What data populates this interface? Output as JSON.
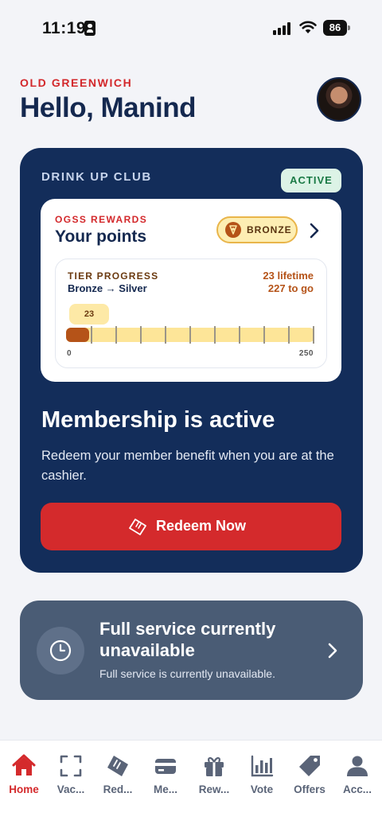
{
  "status_bar": {
    "time": "11:19",
    "battery": "86"
  },
  "header": {
    "location": "OLD GREENWICH",
    "greeting": "Hello, Manind"
  },
  "club_card": {
    "title": "DRINK UP CLUB",
    "status_badge": "ACTIVE",
    "rewards": {
      "program_label": "OGSS REWARDS",
      "title": "Your points",
      "tier_badge": "BRONZE",
      "tier_progress": {
        "label": "TIER PROGRESS",
        "path": "Bronze → Silver",
        "lifetime": "23 lifetime",
        "to_go": "227 to go",
        "current_value": "23",
        "min": "0",
        "max": "250",
        "progress_fraction": 0.092
      }
    },
    "membership_title": "Membership is active",
    "membership_desc": "Redeem your member benefit when you are at the cashier.",
    "redeem_button": "Redeem Now"
  },
  "service_card": {
    "title": "Full service currently unavailable",
    "description": "Full service is currently unavailable."
  },
  "bottom_nav": {
    "items": [
      {
        "label": "Home",
        "icon": "home-icon",
        "active": true
      },
      {
        "label": "Vac...",
        "icon": "scan-icon",
        "active": false
      },
      {
        "label": "Red...",
        "icon": "ticket-icon",
        "active": false
      },
      {
        "label": "Me...",
        "icon": "card-icon",
        "active": false
      },
      {
        "label": "Rew...",
        "icon": "gift-icon",
        "active": false
      },
      {
        "label": "Vote",
        "icon": "chart-icon",
        "active": false
      },
      {
        "label": "Offers",
        "icon": "tag-icon",
        "active": false
      },
      {
        "label": "Acc...",
        "icon": "person-icon",
        "active": false
      }
    ]
  },
  "colors": {
    "brand_navy": "#132d5a",
    "brand_red": "#d42a2c",
    "bronze": "#b55318",
    "service_card": "#4a5c75"
  }
}
